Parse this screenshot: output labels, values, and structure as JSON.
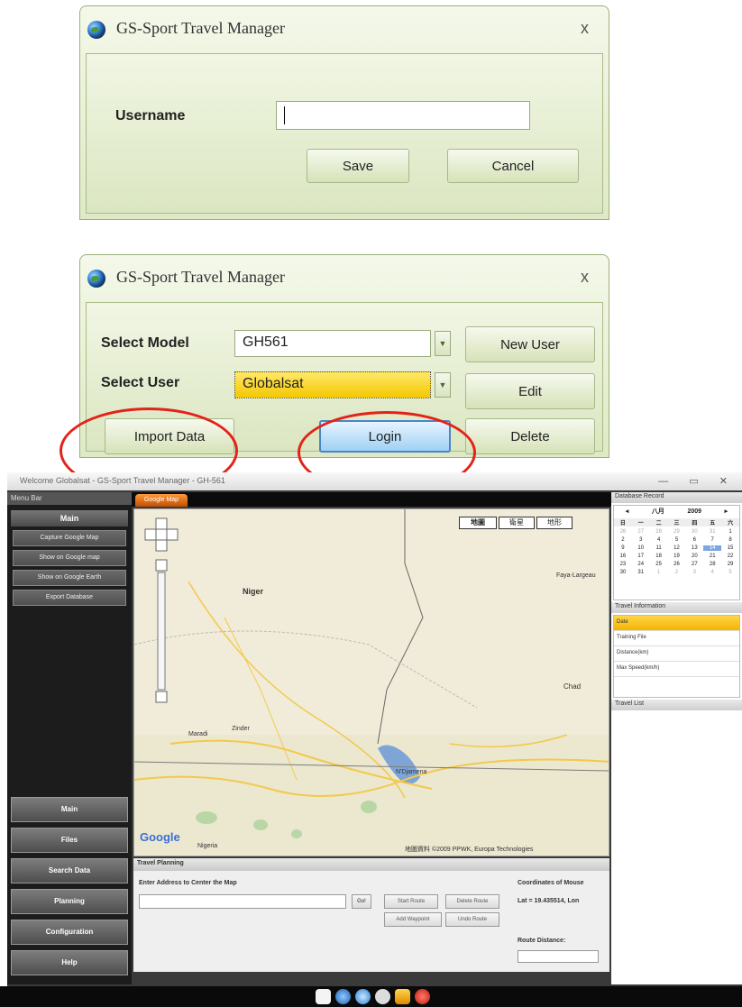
{
  "dialog1": {
    "title": "GS-Sport Travel Manager",
    "close": "x",
    "username_label": "Username",
    "username_value": "",
    "save": "Save",
    "cancel": "Cancel"
  },
  "dialog2": {
    "title": "GS-Sport Travel Manager",
    "close": "x",
    "select_model_label": "Select Model",
    "select_model_value": "GH561",
    "select_user_label": "Select User",
    "select_user_value": "Globalsat",
    "new_user": "New User",
    "edit": "Edit",
    "delete": "Delete",
    "import_data": "Import Data",
    "login": "Login"
  },
  "annotation_color": "#e32218",
  "app": {
    "title": "Welcome Globalsat - GS-Sport Travel Manager - GH-561",
    "menu_bar": "Menu Bar",
    "main_header": "Main",
    "main_items": [
      "Capture Google Map",
      "Show on Google map",
      "Show on Google Earth",
      "Export Database"
    ],
    "nav": [
      "Main",
      "Files",
      "Search Data",
      "Planning",
      "Configuration",
      "Help"
    ],
    "map_tab": "Google Map",
    "map_types": [
      "地圖",
      "衛星",
      "地形"
    ],
    "map_labels": [
      "Niger",
      "Chad",
      "Faya-Largeau",
      "Zinder",
      "Maradi",
      "N'Djamena",
      "Nigeria"
    ],
    "map_attribution": "地圖資料 ©2009 PPWK, Europa Technologies",
    "google_logo": "Google",
    "travel_planning": "Travel Planning",
    "address_label": "Enter Address to Center the Map",
    "go": "Go!",
    "start_route": "Start Route",
    "delete_route": "Delete Route",
    "add_waypoint": "Add Waypoint",
    "undo_route": "Undo Route",
    "coords_label": "Coordinates of Mouse",
    "coords_value": "Lat = 19.435514, Lon",
    "route_distance": "Route Distance:",
    "database_record": "Database Record",
    "cal_month": "八月",
    "cal_year": "2009",
    "cal_days": [
      "日",
      "一",
      "二",
      "三",
      "四",
      "五",
      "六"
    ],
    "cal_dates": [
      "26",
      "27",
      "28",
      "29",
      "30",
      "31",
      "1",
      "2",
      "3",
      "4",
      "5",
      "6",
      "7",
      "8",
      "9",
      "10",
      "11",
      "12",
      "13",
      "14",
      "15",
      "16",
      "17",
      "18",
      "19",
      "20",
      "21",
      "22",
      "23",
      "24",
      "25",
      "26",
      "27",
      "28",
      "29",
      "30",
      "31",
      "1",
      "2",
      "3",
      "4",
      "5"
    ],
    "travel_information": "Travel Information",
    "travel_info_rows": [
      "Date",
      "Training File",
      "Distance(km)",
      "Max Speed(km/h)"
    ],
    "travel_list": "Travel List"
  }
}
